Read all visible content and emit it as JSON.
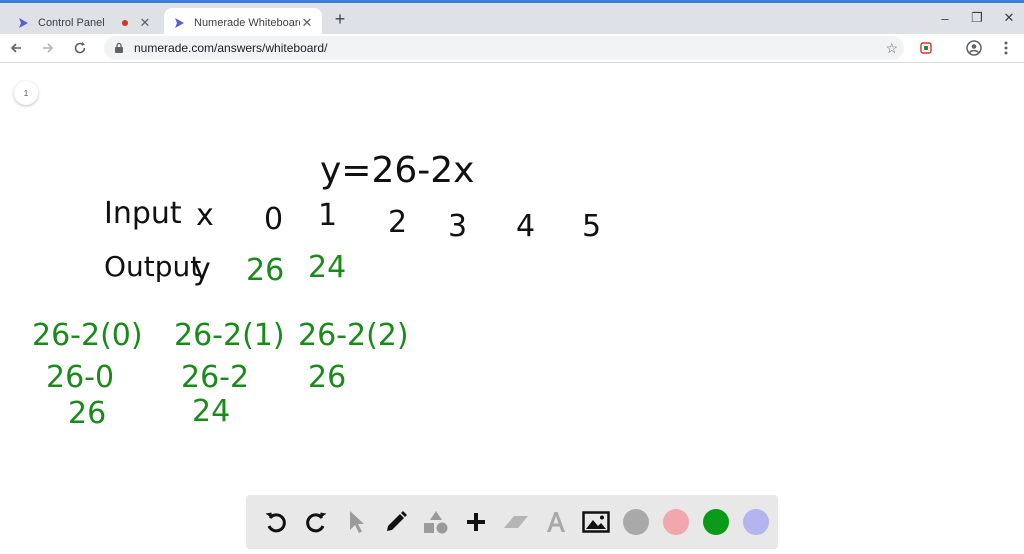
{
  "browser": {
    "tabs": [
      {
        "title": "Control Panel"
      },
      {
        "title": "Numerade Whiteboard"
      }
    ],
    "new_tab": "+",
    "url": "numerade.com/answers/whiteboard/",
    "window": {
      "minimize": "–",
      "maximize": "❐",
      "close": "✕"
    }
  },
  "whiteboard": {
    "page_number": "1",
    "equation": "y=26-2x",
    "input_label": "Input",
    "input_var": "x",
    "output_label": "Output",
    "output_var": "y",
    "inputs": [
      "0",
      "1",
      "2",
      "3",
      "4",
      "5"
    ],
    "outputs": [
      "26",
      "24"
    ],
    "work": [
      {
        "expr": "26-2(0)",
        "step": "26-0",
        "result": "26"
      },
      {
        "expr": "26-2(1)",
        "step": "26-2",
        "result": "24"
      },
      {
        "expr": "26-2(2)",
        "step": "26"
      }
    ]
  },
  "toolbar": {
    "colors": [
      "#a9a9a9",
      "#f1a7ad",
      "#0a9a1a",
      "#b4b4ef"
    ],
    "icons": [
      "undo-icon",
      "redo-icon",
      "pointer-icon",
      "pen-icon",
      "shapes-icon",
      "plus-icon",
      "eraser-icon",
      "text-icon",
      "image-icon"
    ]
  }
}
